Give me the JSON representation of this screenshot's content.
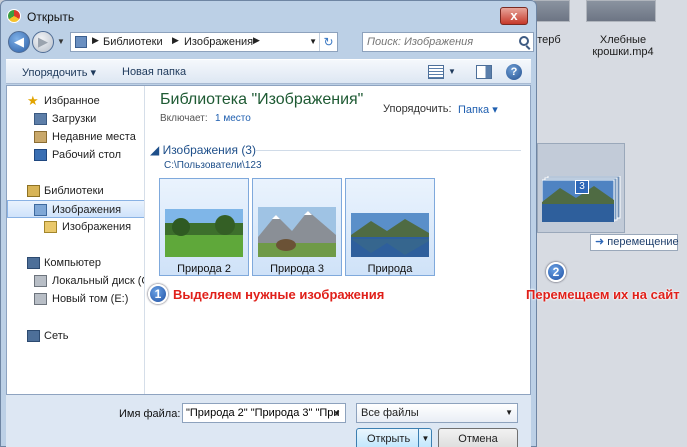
{
  "desktop": {
    "files": [
      {
        "label_line1": "терб",
        "label_line2": ""
      },
      {
        "label_line1": "Хлебные",
        "label_line2": "крошки.mp4"
      }
    ]
  },
  "window": {
    "title": "Открыть",
    "close_label": "x"
  },
  "nav": {
    "back_icon": "back-arrow-icon",
    "breadcrumbs": [
      "Библиотеки",
      "Изображения"
    ],
    "search_placeholder": "Поиск: Изображения"
  },
  "toolbar": {
    "organize_label": "Упорядочить ▾",
    "new_folder_label": "Новая папка",
    "help_label": "?"
  },
  "sidebar": {
    "favorites": {
      "label": "Избранное",
      "items": [
        "Загрузки",
        "Недавние места",
        "Рабочий стол"
      ]
    },
    "libraries": {
      "label": "Библиотеки",
      "items": [
        "Изображения",
        "Изображения"
      ]
    },
    "computer": {
      "label": "Компьютер",
      "items": [
        "Локальный диск (C",
        "Новый том (E:)"
      ]
    },
    "network": {
      "label": "Сеть"
    }
  },
  "main": {
    "library_title": "Библиотека \"Изображения\"",
    "includes_label": "Включает:",
    "includes_value": "1 место",
    "arrange_label": "Упорядочить:",
    "arrange_value": "Папка ▾",
    "group_header": "◢ Изображения (3)",
    "group_path": "C:\\Пользователи\\123",
    "files": [
      {
        "name": "Природа 2"
      },
      {
        "name": "Природа 3"
      },
      {
        "name": "Природа"
      }
    ]
  },
  "bottom": {
    "filename_label": "Имя файла:",
    "filename_value": "\"Природа 2\" \"Природа 3\" \"При",
    "filetype_value": "Все файлы",
    "open_label": "Открыть",
    "cancel_label": "Отмена"
  },
  "annotations": {
    "step1_number": "1",
    "step1_text": "Выделяем нужные изображения",
    "step2_number": "2",
    "step2_text": "Перемещаем их на сайт"
  },
  "drag": {
    "count": "3",
    "tooltip": "перемещение"
  },
  "colors": {
    "annotation_red": "#e0201a",
    "selection_blue": "#cfe2f8",
    "library_title_green": "#1e5a33"
  }
}
